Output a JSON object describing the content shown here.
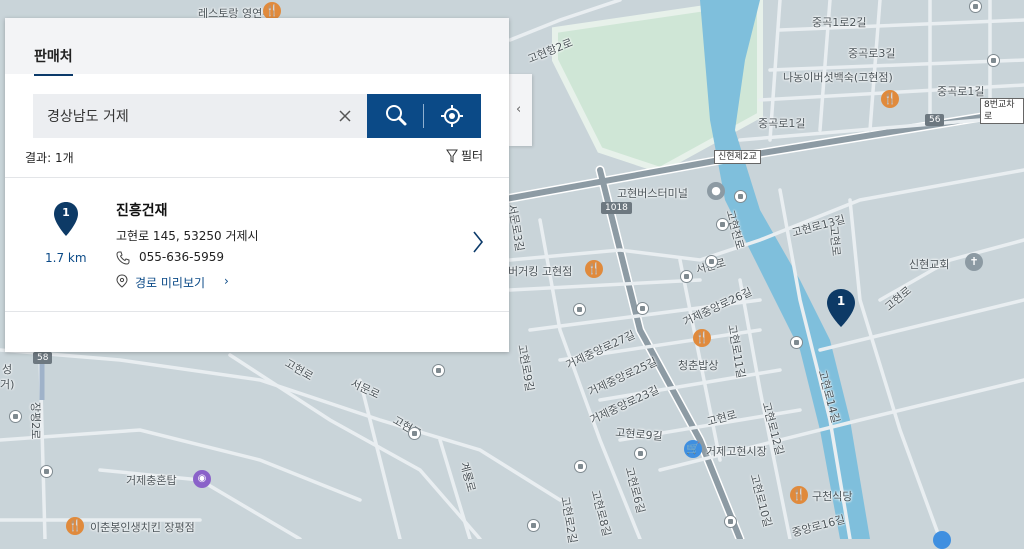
{
  "panel": {
    "tab_label": "판매처",
    "search": {
      "value": "경상남도 거제",
      "placeholder": ""
    },
    "result_count": "결과: 1개",
    "filter_label": "필터",
    "results": [
      {
        "index": "1",
        "distance": "1.7 km",
        "name": "진흥건재",
        "address": "고현로 145, 53250 거제시",
        "phone": "055-636-5959",
        "route_label": "경로 미리보기"
      }
    ]
  },
  "map": {
    "marker_index": "1",
    "labels": {
      "l01": "레스토랑 영연주",
      "l02": "고현항2로",
      "l03": "중곡1로2길",
      "l04": "중곡로3길",
      "l05": "나농이버섯백숙(고현점)",
      "l06": "중곡로1길",
      "l07": "중곡로1길",
      "l08": "8번교차로",
      "l09": "신현제2교",
      "l10": "고현버스터미널",
      "l11": "고현로13길",
      "l12": "서문로3길",
      "l13": "고현천로",
      "l14": "고현로",
      "l15": "신현교회",
      "l16": "버거킹 고현점",
      "l17": "서문로",
      "l18": "거제중앙로26길",
      "l19": "고현로",
      "l20": "거제중앙로27길",
      "l21": "고현로11길",
      "l22": "거제중앙로25길",
      "l23": "청춘밥상",
      "l24": "고현로9길",
      "l25": "거제중앙로23길",
      "l26": "고현로",
      "l27": "서문로",
      "l28": "고현로",
      "l29": "고현로9길",
      "l30": "고현로",
      "l31": "고현로12길",
      "l32": "고현로14길",
      "l33": "거제고현시장",
      "l34": "거제충혼탑",
      "l35": "계룡로",
      "l36": "고현로6길",
      "l37": "고현로8길",
      "l38": "고현로10길",
      "l39": "구천식당",
      "l40": "중앙로16길",
      "l41": "이춘봉인생치킨 장평점",
      "l42": "장평2로",
      "l43": "고현로2길",
      "l44": "성",
      "l45": "거)"
    },
    "shields": {
      "s1": "1018",
      "s2": "56",
      "s3": "58"
    }
  },
  "colors": {
    "accent": "#0b4a87",
    "water": "#7fbfdc",
    "park": "#cfe6d6",
    "road": "#a8b6bf"
  }
}
